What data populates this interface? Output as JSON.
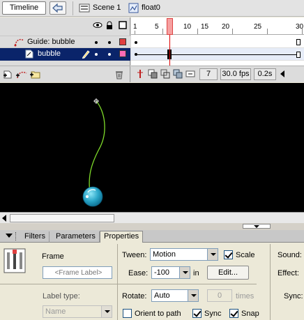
{
  "topbar": {
    "tab_label": "Timeline",
    "scene_label": "Scene 1",
    "symbol_label": "float0"
  },
  "timeline": {
    "layers": [
      {
        "name": "Guide: bubble",
        "type": "guide",
        "color": "#e04040",
        "selected": false
      },
      {
        "name": "bubble",
        "type": "normal",
        "color": "#ff6bb5",
        "selected": true
      }
    ],
    "ruler": [
      "1",
      "5",
      "10",
      "15",
      "20",
      "25",
      "30"
    ],
    "current_frame": 7,
    "status": {
      "frame": "7",
      "fps": "30.0 fps",
      "time": "0.2s"
    }
  },
  "panel": {
    "tabs": [
      "Filters",
      "Parameters",
      "Properties"
    ],
    "active_tab": "Properties",
    "frame_title": "Frame",
    "frame_label_placeholder": "<Frame Label>",
    "label_type_label": "Label type:",
    "label_type_value": "Name",
    "tween_label": "Tween:",
    "tween_value": "Motion",
    "scale_label": "Scale",
    "scale_checked": true,
    "ease_label": "Ease:",
    "ease_value": "-100",
    "ease_suffix": "in",
    "edit_button": "Edit...",
    "rotate_label": "Rotate:",
    "rotate_value": "Auto",
    "times_value": "0",
    "times_label": "times",
    "orient_label": "Orient to path",
    "orient_checked": false,
    "sync_label": "Sync",
    "sync_checked": true,
    "snap_label": "Snap",
    "snap_checked": true,
    "sound_label": "Sound:",
    "effect_label": "Effect:",
    "sync_right_label": "Sync:"
  },
  "colors": {
    "selection": "#0a246a",
    "stage": "#000000",
    "guide_path": "#7fdc2a",
    "bubble": "#2aa6c8",
    "playhead": "#e03030"
  }
}
